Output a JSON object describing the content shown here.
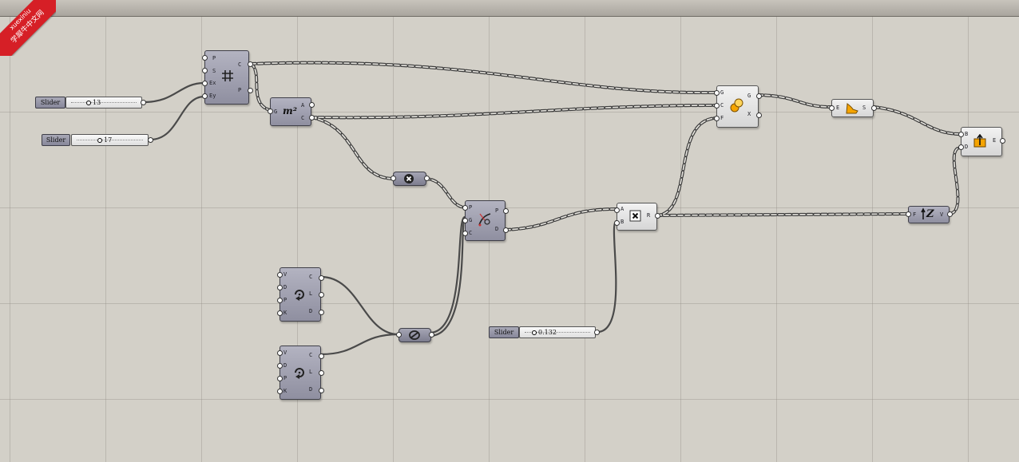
{
  "watermark": {
    "line1": "xuexiniu",
    "line2": "学犀牛中文网",
    "color": "#d61f26"
  },
  "sliders": [
    {
      "label": "Slider",
      "value": "13"
    },
    {
      "label": "Slider",
      "value": "17"
    },
    {
      "label": "Slider",
      "value": "0.132"
    }
  ],
  "components": {
    "rect_grid": {
      "inputs": [
        "P",
        "S",
        "Ex",
        "Ey"
      ],
      "outputs": [
        "C",
        "P"
      ],
      "icon": "grid-hash-icon"
    },
    "area": {
      "inputs": [
        "G"
      ],
      "outputs": [
        "A",
        "C"
      ],
      "icon": "m2",
      "icon_text": "m²"
    },
    "negative": {
      "icon": "x-circle-icon"
    },
    "closest_point": {
      "inputs": [
        "P",
        "G",
        "C"
      ],
      "outputs": [
        "P",
        "D"
      ],
      "icon": "closest-point-icon"
    },
    "divide_1": {
      "inputs": [
        "V",
        "D",
        "P",
        "K"
      ],
      "outputs": [
        "C",
        "L",
        "D"
      ],
      "icon": "divide-curve-icon"
    },
    "divide_2": {
      "inputs": [
        "V",
        "D",
        "P",
        "K"
      ],
      "outputs": [
        "C",
        "L",
        "D"
      ],
      "icon": "divide-curve-icon"
    },
    "merge": {
      "icon": "merge-icon"
    },
    "multiply": {
      "inputs": [
        "A",
        "B"
      ],
      "outputs": [
        "R"
      ],
      "icon": "multiply-icon"
    },
    "scale": {
      "inputs": [
        "G",
        "C",
        "F"
      ],
      "outputs": [
        "G",
        "X"
      ],
      "icon": "scale-icon"
    },
    "extrude_surface": {
      "inputs": [
        "E"
      ],
      "outputs": [
        "S"
      ],
      "icon": "surface-icon"
    },
    "unit_z": {
      "inputs": [
        "F"
      ],
      "outputs": [
        "V"
      ],
      "icon": "unit-z-icon",
      "icon_text": "Z"
    },
    "extrude": {
      "inputs": [
        "B",
        "D"
      ],
      "outputs": [
        "E"
      ],
      "icon": "extrude-icon"
    }
  },
  "colors": {
    "canvas": "#d3d0c8",
    "component": "#9a9aab",
    "wire": "#555555",
    "accent": "#f5a400"
  }
}
